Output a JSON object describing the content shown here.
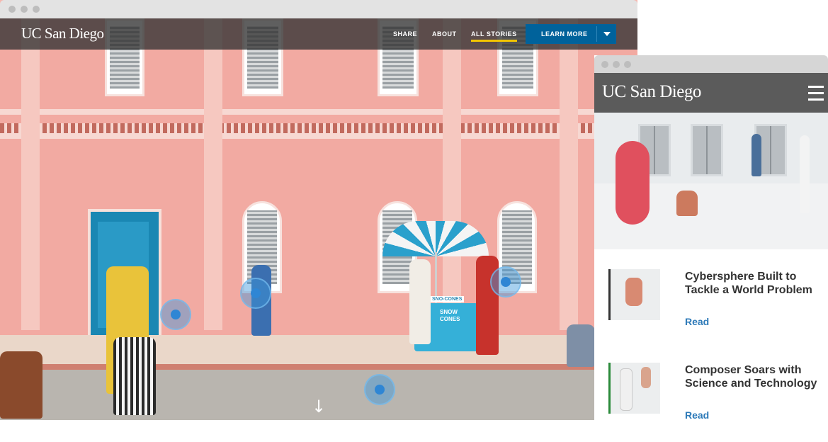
{
  "desktop": {
    "logo": "UC San Diego",
    "nav": [
      "SHARE",
      "ABOUT",
      "ALL STORIES"
    ],
    "active_nav": "ALL STORIES",
    "cta_label": "LEARN MORE",
    "cart_sign": "SNO-CONES",
    "cart_text": "SNOW CONES",
    "scroll_hint": "↓"
  },
  "mobile": {
    "logo": "UC San Diego",
    "stories": [
      {
        "title": "Cybersphere Built to Tackle a World Problem",
        "link": "Read"
      },
      {
        "title": "Composer Soars with Science and Technology",
        "link": "Read"
      }
    ]
  },
  "colors": {
    "nav_bg": "#333333",
    "cta_blue": "#00629b",
    "active_underline": "#f2c500",
    "link_blue": "#2d7ab8",
    "building_pink": "#f2aaa2"
  },
  "icons": [
    "chevron-down-icon",
    "hamburger-menu-icon",
    "scroll-down-arrow-icon",
    "hotspot-icon"
  ]
}
